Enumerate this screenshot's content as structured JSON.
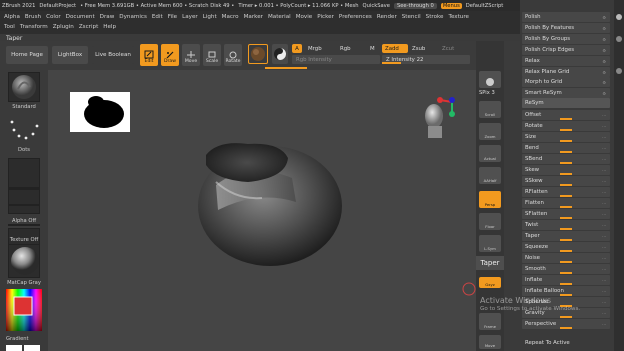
{
  "titlebar": {
    "items": [
      "ZBrush 2021",
      "DefaultProject",
      "• Free Mem 3.691GB • Active Mem 600 • Scratch Disk 49 •",
      "Timer ▸ 0.001 • PolyCount ▸ 11.066 KP • Mesh",
      "QuickSave"
    ],
    "see_through": "See-through 0",
    "menus": "Menus",
    "script": "DefaultZScript",
    "controls": [
      "–",
      "□",
      "×"
    ]
  },
  "menubar": {
    "row1": [
      "Alpha",
      "Brush",
      "Color",
      "Document",
      "Draw",
      "Dynamics",
      "Edit",
      "File",
      "Layer",
      "Light",
      "Macro",
      "Marker",
      "Material",
      "Movie",
      "Picker",
      "Preferences",
      "Render",
      "Stencil",
      "Stroke",
      "Texture"
    ],
    "row2": [
      "Tool",
      "Transform",
      "Zplugin",
      "Zscript",
      "Help"
    ]
  },
  "tool_title": "Taper",
  "shelf": {
    "home_page": "Home Page",
    "lightbox": "LightBox",
    "live_boolean": "Live Boolean",
    "edit": "Edit",
    "draw": "Draw",
    "move": "Move",
    "scale": "Scale",
    "rotate": "Rotate",
    "a_btn": "A",
    "mrgb": "Mrgb",
    "rgb": "Rgb",
    "m": "M",
    "zadd": "Zadd",
    "zsub": "Zsub",
    "zcut": "Zcut",
    "rgb_intensity": "Rgb Intensity",
    "z_intensity": "Z Intensity 22",
    "z_intensity_level": 0.22
  },
  "left": {
    "brush": "Standard",
    "stroke": "Dots",
    "alpha": "Alpha Off",
    "texture": "Texture Off",
    "material": "MatCap Gray",
    "gradient": "Gradient"
  },
  "vtools": {
    "spix": "SPix 3",
    "scroll": "Scroll",
    "zoom": "Zoom",
    "actual": "Actual",
    "aahalf": "AAHalf",
    "persp": "Persp",
    "floor": "Floor",
    "lsym": "L.Sym",
    "gxyz": "Gxyz",
    "frame": "Frame",
    "move": "Move",
    "taper_tooltip": "Taper"
  },
  "right": {
    "top_items": [
      {
        "label": "Polish",
        "y": 12
      },
      {
        "label": "Polish By Features",
        "y": 23
      },
      {
        "label": "Polish By Groups",
        "y": 34
      },
      {
        "label": "Polish Crisp Edges",
        "y": 45
      },
      {
        "label": "Relax",
        "y": 56
      },
      {
        "label": "Relax Plane Grid",
        "y": 67
      },
      {
        "label": "Morph to Grid",
        "y": 77
      },
      {
        "label": "Smart ReSym",
        "y": 88
      }
    ],
    "resym": "ReSym",
    "deformers": [
      {
        "label": "Offset",
        "fill": 0.5
      },
      {
        "label": "Rotate",
        "fill": 0.5
      },
      {
        "label": "Size",
        "fill": 0.5
      },
      {
        "label": "Bend",
        "fill": 0.5
      },
      {
        "label": "SBend",
        "fill": 0.5
      },
      {
        "label": "Skew",
        "fill": 0.5
      },
      {
        "label": "SSkew",
        "fill": 0.5
      },
      {
        "label": "RFlatten",
        "fill": 0.5
      },
      {
        "label": "Flatten",
        "fill": 0.5
      },
      {
        "label": "SFlatten",
        "fill": 0.5
      },
      {
        "label": "Twist",
        "fill": 0.5
      },
      {
        "label": "Taper",
        "fill": 0.5
      },
      {
        "label": "Squeeze",
        "fill": 0.5
      },
      {
        "label": "Noise",
        "fill": 0.5
      },
      {
        "label": "Smooth",
        "fill": 0.5
      },
      {
        "label": "Inflate",
        "fill": 0.5
      },
      {
        "label": "Inflate Balloon",
        "fill": 0.5
      },
      {
        "label": "Spherize",
        "fill": 0.5
      },
      {
        "label": "Gravity",
        "fill": 0.5
      },
      {
        "label": "Perspective",
        "fill": 0.5
      }
    ],
    "repeat": "Repeat To Active"
  },
  "watermark": {
    "title": "Activate Windows",
    "sub": "Go to Settings to activate Windows."
  },
  "colors": {
    "accent": "#f29a1f",
    "panel": "#3a3a3a",
    "canvas": "#454545"
  }
}
